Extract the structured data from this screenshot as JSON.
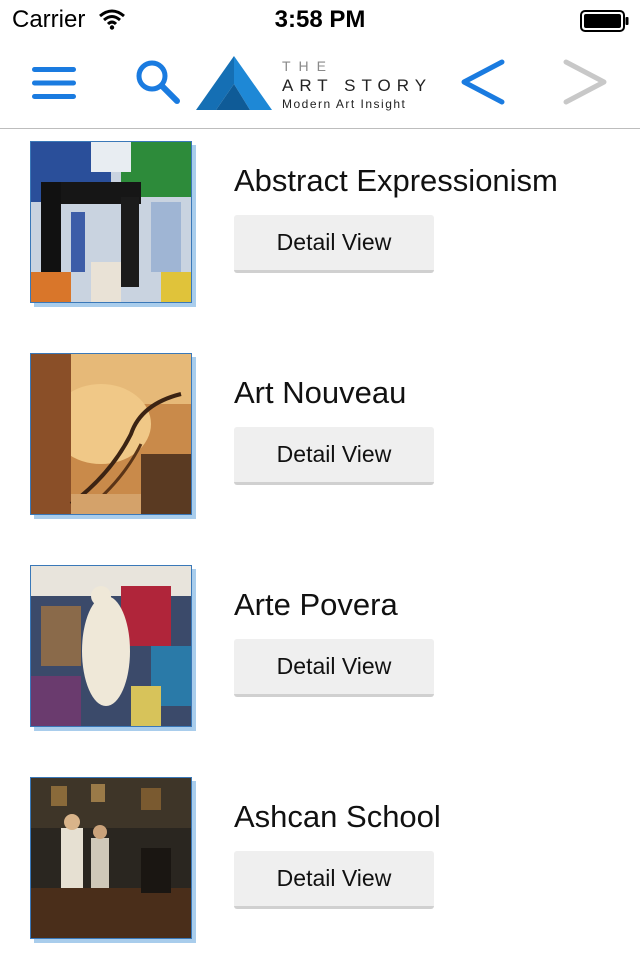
{
  "status_bar": {
    "carrier": "Carrier",
    "time": "3:58 PM",
    "icons": [
      "wifi-icon",
      "battery-icon"
    ]
  },
  "nav": {
    "icons": [
      "menu-icon",
      "search-icon",
      "back-chevron-icon",
      "forward-chevron-icon"
    ],
    "logo": {
      "the": "THE",
      "name": "ART STORY",
      "tagline": "Modern Art Insight"
    },
    "colors": {
      "accent": "#1a7be0",
      "disabled": "#c8c8c8"
    }
  },
  "movements": [
    {
      "title": "Abstract Expressionism",
      "button_label": "Detail View"
    },
    {
      "title": "Art Nouveau",
      "button_label": "Detail View"
    },
    {
      "title": "Arte Povera",
      "button_label": "Detail View"
    },
    {
      "title": "Ashcan School",
      "button_label": "Detail View"
    }
  ]
}
